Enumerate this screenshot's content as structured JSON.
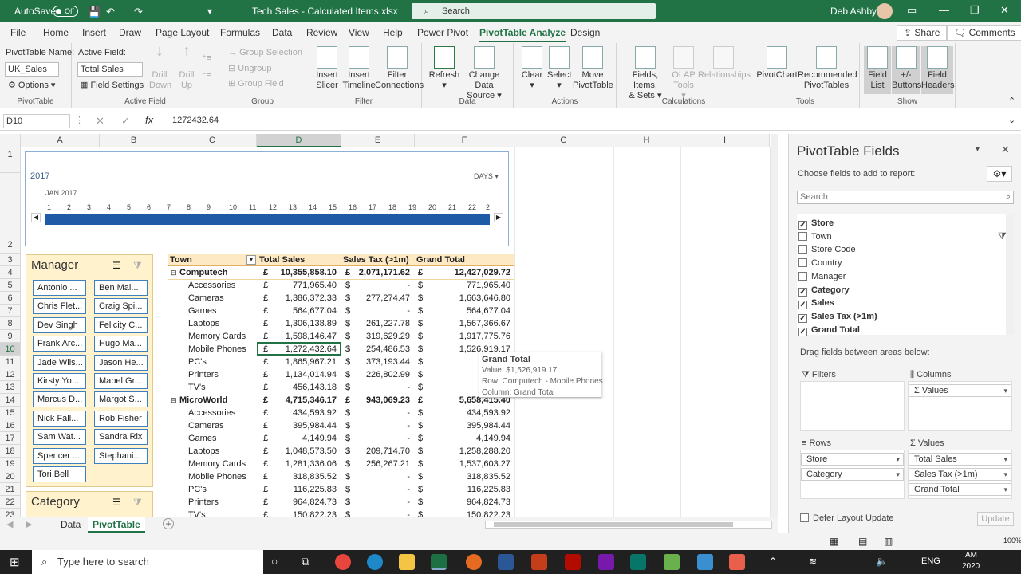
{
  "titlebar": {
    "autosave": "AutoSave",
    "toggle": "Off",
    "filename": "Tech Sales - Calculated Items.xlsx",
    "search": "Search",
    "user": "Deb Ashby"
  },
  "tabs": [
    "File",
    "Home",
    "Insert",
    "Draw",
    "Page Layout",
    "Formulas",
    "Data",
    "Review",
    "View",
    "Help",
    "Power Pivot",
    "PivotTable Analyze",
    "Design"
  ],
  "share": "Share",
  "comments": "Comments",
  "ribbon": {
    "pivot_name_label": "PivotTable Name:",
    "pivot_name": "UK_Sales",
    "options": "Options",
    "pivottable_group": "PivotTable",
    "active_field_label": "Active Field:",
    "active_field": "Total Sales",
    "field_settings": "Field Settings",
    "drill_down": [
      "Drill",
      "Down"
    ],
    "drill_up": [
      "Drill",
      "Up"
    ],
    "active_field_group": "Active Field",
    "group_selection": "Group Selection",
    "ungroup": "Ungroup",
    "group_field": "Group Field",
    "group_group": "Group",
    "insert_slicer": [
      "Insert",
      "Slicer"
    ],
    "insert_timeline": [
      "Insert",
      "Timeline"
    ],
    "filter_connections": [
      "Filter",
      "Connections"
    ],
    "filter_group": "Filter",
    "refresh": "Refresh",
    "change_data_source": [
      "Change Data",
      "Source"
    ],
    "data_group": "Data",
    "clear": "Clear",
    "select": "Select",
    "move_pivot": [
      "Move",
      "PivotTable"
    ],
    "actions_group": "Actions",
    "fields_items": [
      "Fields, Items,",
      "& Sets"
    ],
    "olap": [
      "OLAP",
      "Tools"
    ],
    "relationships": "Relationships",
    "calculations_group": "Calculations",
    "pivotchart": "PivotChart",
    "recommended": [
      "Recommended",
      "PivotTables"
    ],
    "tools_group": "Tools",
    "field_list": [
      "Field",
      "List"
    ],
    "buttons": [
      "+/-",
      "Buttons"
    ],
    "field_headers": [
      "Field",
      "Headers"
    ],
    "show_group": "Show"
  },
  "formula": {
    "namebox": "D10",
    "value": "1272432.64"
  },
  "columns": [
    "A",
    "B",
    "C",
    "D",
    "E",
    "F",
    "G",
    "H",
    "I"
  ],
  "rows": [
    "1",
    "2",
    "3",
    "4",
    "5",
    "6",
    "7",
    "8",
    "9",
    "10",
    "11",
    "12",
    "13",
    "14",
    "15",
    "16",
    "17",
    "18",
    "19",
    "20",
    "21",
    "22",
    "23"
  ],
  "timeline": {
    "year": "2017",
    "units": "DAYS",
    "month": "JAN 2017",
    "days": [
      "1",
      "2",
      "3",
      "4",
      "5",
      "6",
      "7",
      "8",
      "9",
      "10",
      "11",
      "12",
      "13",
      "14",
      "15",
      "16",
      "17",
      "18",
      "19",
      "20",
      "21",
      "22",
      "2"
    ]
  },
  "slicer_manager": {
    "title": "Manager",
    "items": [
      "Antonio ...",
      "Ben Mal...",
      "Chris Flet...",
      "Craig Spi...",
      "Dev Singh",
      "Felicity C...",
      "Frank Arc...",
      "Hugo Ma...",
      "Jade Wils...",
      "Jason He...",
      "Kirsty Yo...",
      "Mabel Gr...",
      "Marcus D...",
      "Margot S...",
      "Nick Fall...",
      "Rob Fisher",
      "Sam Wat...",
      "Sandra Rix",
      "Spencer ...",
      "Stephani...",
      "Tori Bell"
    ]
  },
  "slicer_category": {
    "title": "Category"
  },
  "pivot": {
    "headers": [
      "Town",
      "Total Sales",
      "Sales Tax (>1m)",
      "Grand Total"
    ],
    "rows": [
      {
        "label": "Computech",
        "b": true,
        "c1": "£",
        "v1": "10,355,858.10",
        "c2": "£",
        "v2": "2,071,171.62",
        "c3": "£",
        "v3": "12,427,029.72"
      },
      {
        "label": "Accessories",
        "c1": "£",
        "v1": "771,965.40",
        "c2": "$",
        "v2": "-",
        "c3": "$",
        "v3": "771,965.40"
      },
      {
        "label": "Cameras",
        "c1": "£",
        "v1": "1,386,372.33",
        "c2": "$",
        "v2": "277,274.47",
        "c3": "$",
        "v3": "1,663,646.80"
      },
      {
        "label": "Games",
        "c1": "£",
        "v1": "564,677.04",
        "c2": "$",
        "v2": "-",
        "c3": "$",
        "v3": "564,677.04"
      },
      {
        "label": "Laptops",
        "c1": "£",
        "v1": "1,306,138.89",
        "c2": "$",
        "v2": "261,227.78",
        "c3": "$",
        "v3": "1,567,366.67"
      },
      {
        "label": "Memory Cards",
        "c1": "£",
        "v1": "1,598,146.47",
        "c2": "$",
        "v2": "319,629.29",
        "c3": "$",
        "v3": "1,917,775.76"
      },
      {
        "label": "Mobile Phones",
        "c1": "£",
        "v1": "1,272,432.64",
        "c2": "$",
        "v2": "254,486.53",
        "c3": "$",
        "v3": "1,526,919.17"
      },
      {
        "label": "PC's",
        "c1": "£",
        "v1": "1,865,967.21",
        "c2": "$",
        "v2": "373,193.44",
        "c3": "$",
        "v3": "2,239"
      },
      {
        "label": "Printers",
        "c1": "£",
        "v1": "1,134,014.94",
        "c2": "$",
        "v2": "226,802.99",
        "c3": "$",
        "v3": "1,360"
      },
      {
        "label": "TV's",
        "c1": "£",
        "v1": "456,143.18",
        "c2": "$",
        "v2": "-",
        "c3": "$",
        "v3": "456"
      },
      {
        "label": "MicroWorld",
        "b": true,
        "c1": "£",
        "v1": "4,715,346.17",
        "c2": "£",
        "v2": "943,069.23",
        "c3": "£",
        "v3": "5,658,415.40"
      },
      {
        "label": "Accessories",
        "c1": "£",
        "v1": "434,593.92",
        "c2": "$",
        "v2": "-",
        "c3": "$",
        "v3": "434,593.92"
      },
      {
        "label": "Cameras",
        "c1": "£",
        "v1": "395,984.44",
        "c2": "$",
        "v2": "-",
        "c3": "$",
        "v3": "395,984.44"
      },
      {
        "label": "Games",
        "c1": "£",
        "v1": "4,149.94",
        "c2": "$",
        "v2": "-",
        "c3": "$",
        "v3": "4,149.94"
      },
      {
        "label": "Laptops",
        "c1": "£",
        "v1": "1,048,573.50",
        "c2": "$",
        "v2": "209,714.70",
        "c3": "$",
        "v3": "1,258,288.20"
      },
      {
        "label": "Memory Cards",
        "c1": "£",
        "v1": "1,281,336.06",
        "c2": "$",
        "v2": "256,267.21",
        "c3": "$",
        "v3": "1,537,603.27"
      },
      {
        "label": "Mobile Phones",
        "c1": "£",
        "v1": "318,835.52",
        "c2": "$",
        "v2": "-",
        "c3": "$",
        "v3": "318,835.52"
      },
      {
        "label": "PC's",
        "c1": "£",
        "v1": "116,225.83",
        "c2": "$",
        "v2": "-",
        "c3": "$",
        "v3": "116,225.83"
      },
      {
        "label": "Printers",
        "c1": "£",
        "v1": "964,824.73",
        "c2": "$",
        "v2": "-",
        "c3": "$",
        "v3": "964,824.73"
      },
      {
        "label": "TV's",
        "c1": "£",
        "v1": "150,822.23",
        "c2": "$",
        "v2": "-",
        "c3": "$",
        "v3": "150,822.23"
      }
    ]
  },
  "tooltip": {
    "title": "Grand Total",
    "value": "Value: $1,526,919.17",
    "row": "Row: Computech - Mobile Phones",
    "column": "Column: Grand Total"
  },
  "sheets": [
    "Data",
    "PivotTable"
  ],
  "pane": {
    "title": "PivotTable Fields",
    "choose": "Choose fields to add to report:",
    "search": "Search",
    "fields": [
      {
        "name": "Store",
        "checked": true
      },
      {
        "name": "Town",
        "checked": false
      },
      {
        "name": "Store Code",
        "checked": false
      },
      {
        "name": "Country",
        "checked": false
      },
      {
        "name": "Manager",
        "checked": false
      },
      {
        "name": "Category",
        "checked": true
      },
      {
        "name": "Sales",
        "checked": true
      },
      {
        "name": "Sales Tax (>1m)",
        "checked": true
      },
      {
        "name": "Grand Total",
        "checked": true
      }
    ],
    "drag": "Drag fields between areas below:",
    "filters": "Filters",
    "columns": "Columns",
    "rows": "Rows",
    "values": "Values",
    "col_chip": "Σ Values",
    "row_chips": [
      "Store",
      "Category"
    ],
    "value_chips": [
      "Total Sales",
      "Sales Tax (>1m)",
      "Grand Total"
    ],
    "defer": "Defer Layout Update",
    "update": "Update"
  },
  "taskbar": {
    "search": "Type here to search",
    "lang": "ENG",
    "time": "AM",
    "year": "2020"
  },
  "status": {
    "zoom": "100%"
  }
}
